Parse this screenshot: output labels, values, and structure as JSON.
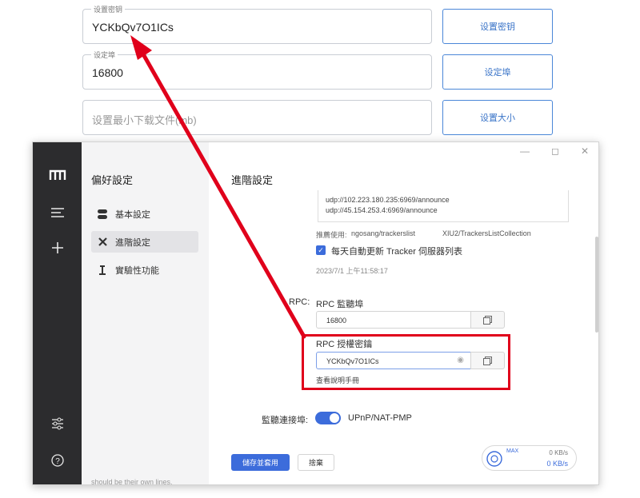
{
  "bg_form": {
    "key_legend": "设置密钥",
    "key_value": "YCKbQv7O1ICs",
    "key_button": "设置密钥",
    "port_legend": "设定埠",
    "port_value": "16800",
    "port_button": "设定埠",
    "size_placeholder": "设置最小下载文件(mb)",
    "size_button": "设置大小"
  },
  "window": {
    "sidebar_title": "偏好設定",
    "nav": [
      "基本設定",
      "進階設定",
      "實驗性功能"
    ],
    "main_title": "進階設定",
    "tracker_lines": [
      "udp://102.223.180.235:6969/announce",
      "udp://45.154.253.4:6969/announce"
    ],
    "recommend_prefix": "推薦使用:",
    "recommend_link1": "ngosang/trackerslist",
    "recommend_link2": "XIU2/TrackersListCollection",
    "auto_update_label": "每天自動更新 Tracker 伺服器列表",
    "last_update": "2023/7/1 上午11:58:17",
    "rpc_label": "RPC:",
    "rpc_port_label": "RPC 監聽埠",
    "rpc_port_value": "16800",
    "rpc_secret_label": "RPC 授權密鑰",
    "rpc_secret_value": "YCKbQv7O1ICs",
    "help_link": "查看說明手冊",
    "listen_port_label": "監聽連接埠:",
    "upnp_label": "UPnP/NAT-PMP",
    "save_button": "儲存並套用",
    "discard_button": "捨棄",
    "speed_max": "MAX",
    "speed_up": "0 KB/s",
    "speed_down": "0 KB/s",
    "sidebar_footer": "should be their own lines."
  },
  "colors": {
    "accent": "#3c6cdb",
    "highlight": "#e0001b"
  }
}
